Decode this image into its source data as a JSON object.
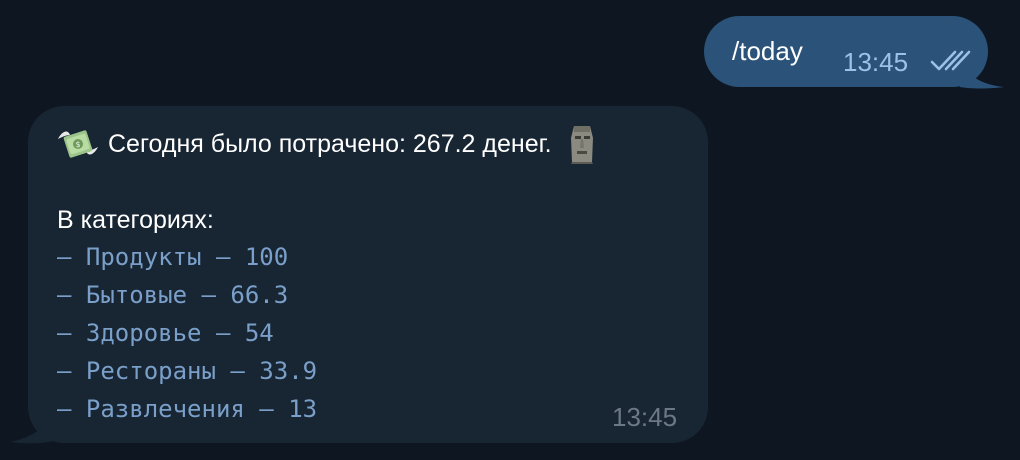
{
  "outgoing_message": {
    "text": "/today",
    "time": "13:45",
    "status_icon": "double-check-icon"
  },
  "incoming_message": {
    "leading_icon": "money-with-wings-icon",
    "summary_text": "Сегодня было потрачено: 267.2 денег.",
    "trailing_icon": "moai-icon",
    "categories_label": "В категориях:",
    "categories": [
      "— Продукты — 100",
      "— Бытовые — 66.3",
      "— Здоровье — 54",
      "— Рестораны — 33.9",
      "— Развлечения — 13"
    ],
    "time": "13:45"
  },
  "colors": {
    "background": "#0e1621",
    "outgoing_bubble": "#2b5278",
    "incoming_bubble": "#182533",
    "outgoing_meta": "#9cc1e6",
    "incoming_meta": "#6c7883",
    "monospace_text": "#7a9fc9"
  }
}
